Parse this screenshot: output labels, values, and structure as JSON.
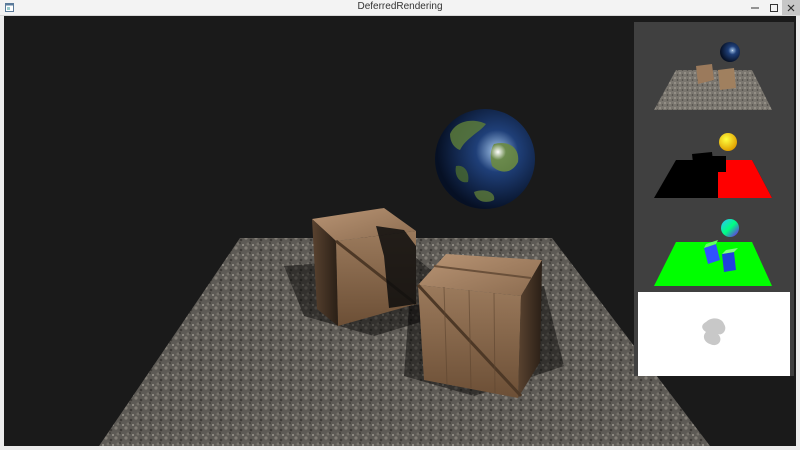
{
  "window": {
    "title": "DeferredRendering"
  },
  "icons": {
    "app": "app-window-icon",
    "minimize": "minimize-icon",
    "maximize": "maximize-icon",
    "close": "close-icon"
  },
  "colors": {
    "viewport_bg": "#1a1a1a",
    "gbuffer_panel_bg": "#404040",
    "depth_floor_left": "#000000",
    "depth_floor_right": "#ff0000",
    "normal_floor": "#00ff00",
    "light_pass_bg": "#ffffff"
  },
  "gbuffer_panels": [
    "albedo-view",
    "position-view",
    "normal-view",
    "light-view"
  ]
}
